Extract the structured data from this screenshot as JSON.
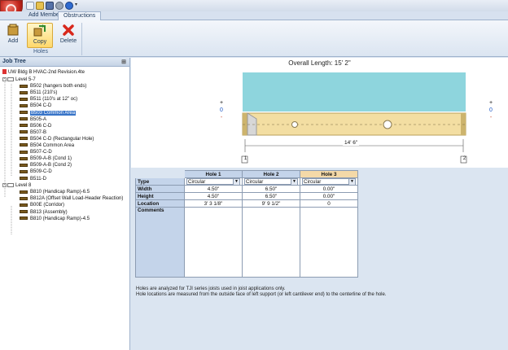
{
  "ribbon": {
    "tabs": [
      "Add Members",
      "Obstructions"
    ],
    "active_tab": "Obstructions",
    "buttons": {
      "add": "Add",
      "copy": "Copy",
      "delete": "Delete"
    },
    "group_label": "Holes"
  },
  "job_tree": {
    "title": "Job Tree",
    "project": "UW Bldg B HVAC-2nd Revision.4te",
    "levels": [
      {
        "name": "Level 5-7",
        "expander": "-",
        "members": [
          "B502 (hangers both ends)",
          "B511 (210's)",
          "B511 (110's at 12\" oc)",
          "B504 C-D",
          "B503 Common Area",
          "B505-A",
          "B506 C-D",
          "B507-B",
          "B504 C-D (Rectangular Hole)",
          "B504 Common Area",
          "B507-C-D",
          "B509-A-B (Cond 1)",
          "B509-A-B (Cond 2)",
          "B509-C-D",
          "B511-D"
        ]
      },
      {
        "name": "Level 8",
        "expander": "-",
        "members": [
          "B810 (Handicap Ramp)-6.5",
          "B812A (Offset Wall Load-Header Reaction)",
          "B00E (Corridor)",
          "B813 (Assembly)",
          "B810 (Handicap Ramp)-4.5"
        ]
      }
    ],
    "selected_member": "B503 Common Area"
  },
  "diagram": {
    "overall_length": "Overall Length: 15' 2\"",
    "span_dimension": "14' 6\"",
    "support_labels": [
      "1",
      "2"
    ],
    "left_markers": [
      "+",
      "0",
      "-"
    ],
    "right_markers": [
      "+",
      "0",
      "-"
    ],
    "colors": {
      "cyan_band": "#8ed5dd",
      "joist": "#f3dea2",
      "joist_edge": "#b9a05a"
    }
  },
  "holes_table": {
    "column_headers": [
      "Hole 1",
      "Hole 2",
      "Hole 3"
    ],
    "active_column": "Hole 3",
    "row_labels": {
      "type": "Type",
      "width": "Width",
      "height": "Height",
      "location": "Location",
      "comments": "Comments"
    },
    "types": [
      "Circular",
      "Circular",
      "Circular"
    ],
    "widths": [
      "4.50\"",
      "6.50\"",
      "0.00\""
    ],
    "heights": [
      "4.50\"",
      "6.50\"",
      "0.00\""
    ],
    "locations": [
      "3' 3 1/8\"",
      "9' 9 1/2\"",
      "0"
    ]
  },
  "notes": {
    "line1": "Holes are analyzed for TJI series joists used in joist applications only.",
    "line2": "Hole locations are measured from the outside face of left support (or left cantilever end) to the centerline of the hole."
  }
}
